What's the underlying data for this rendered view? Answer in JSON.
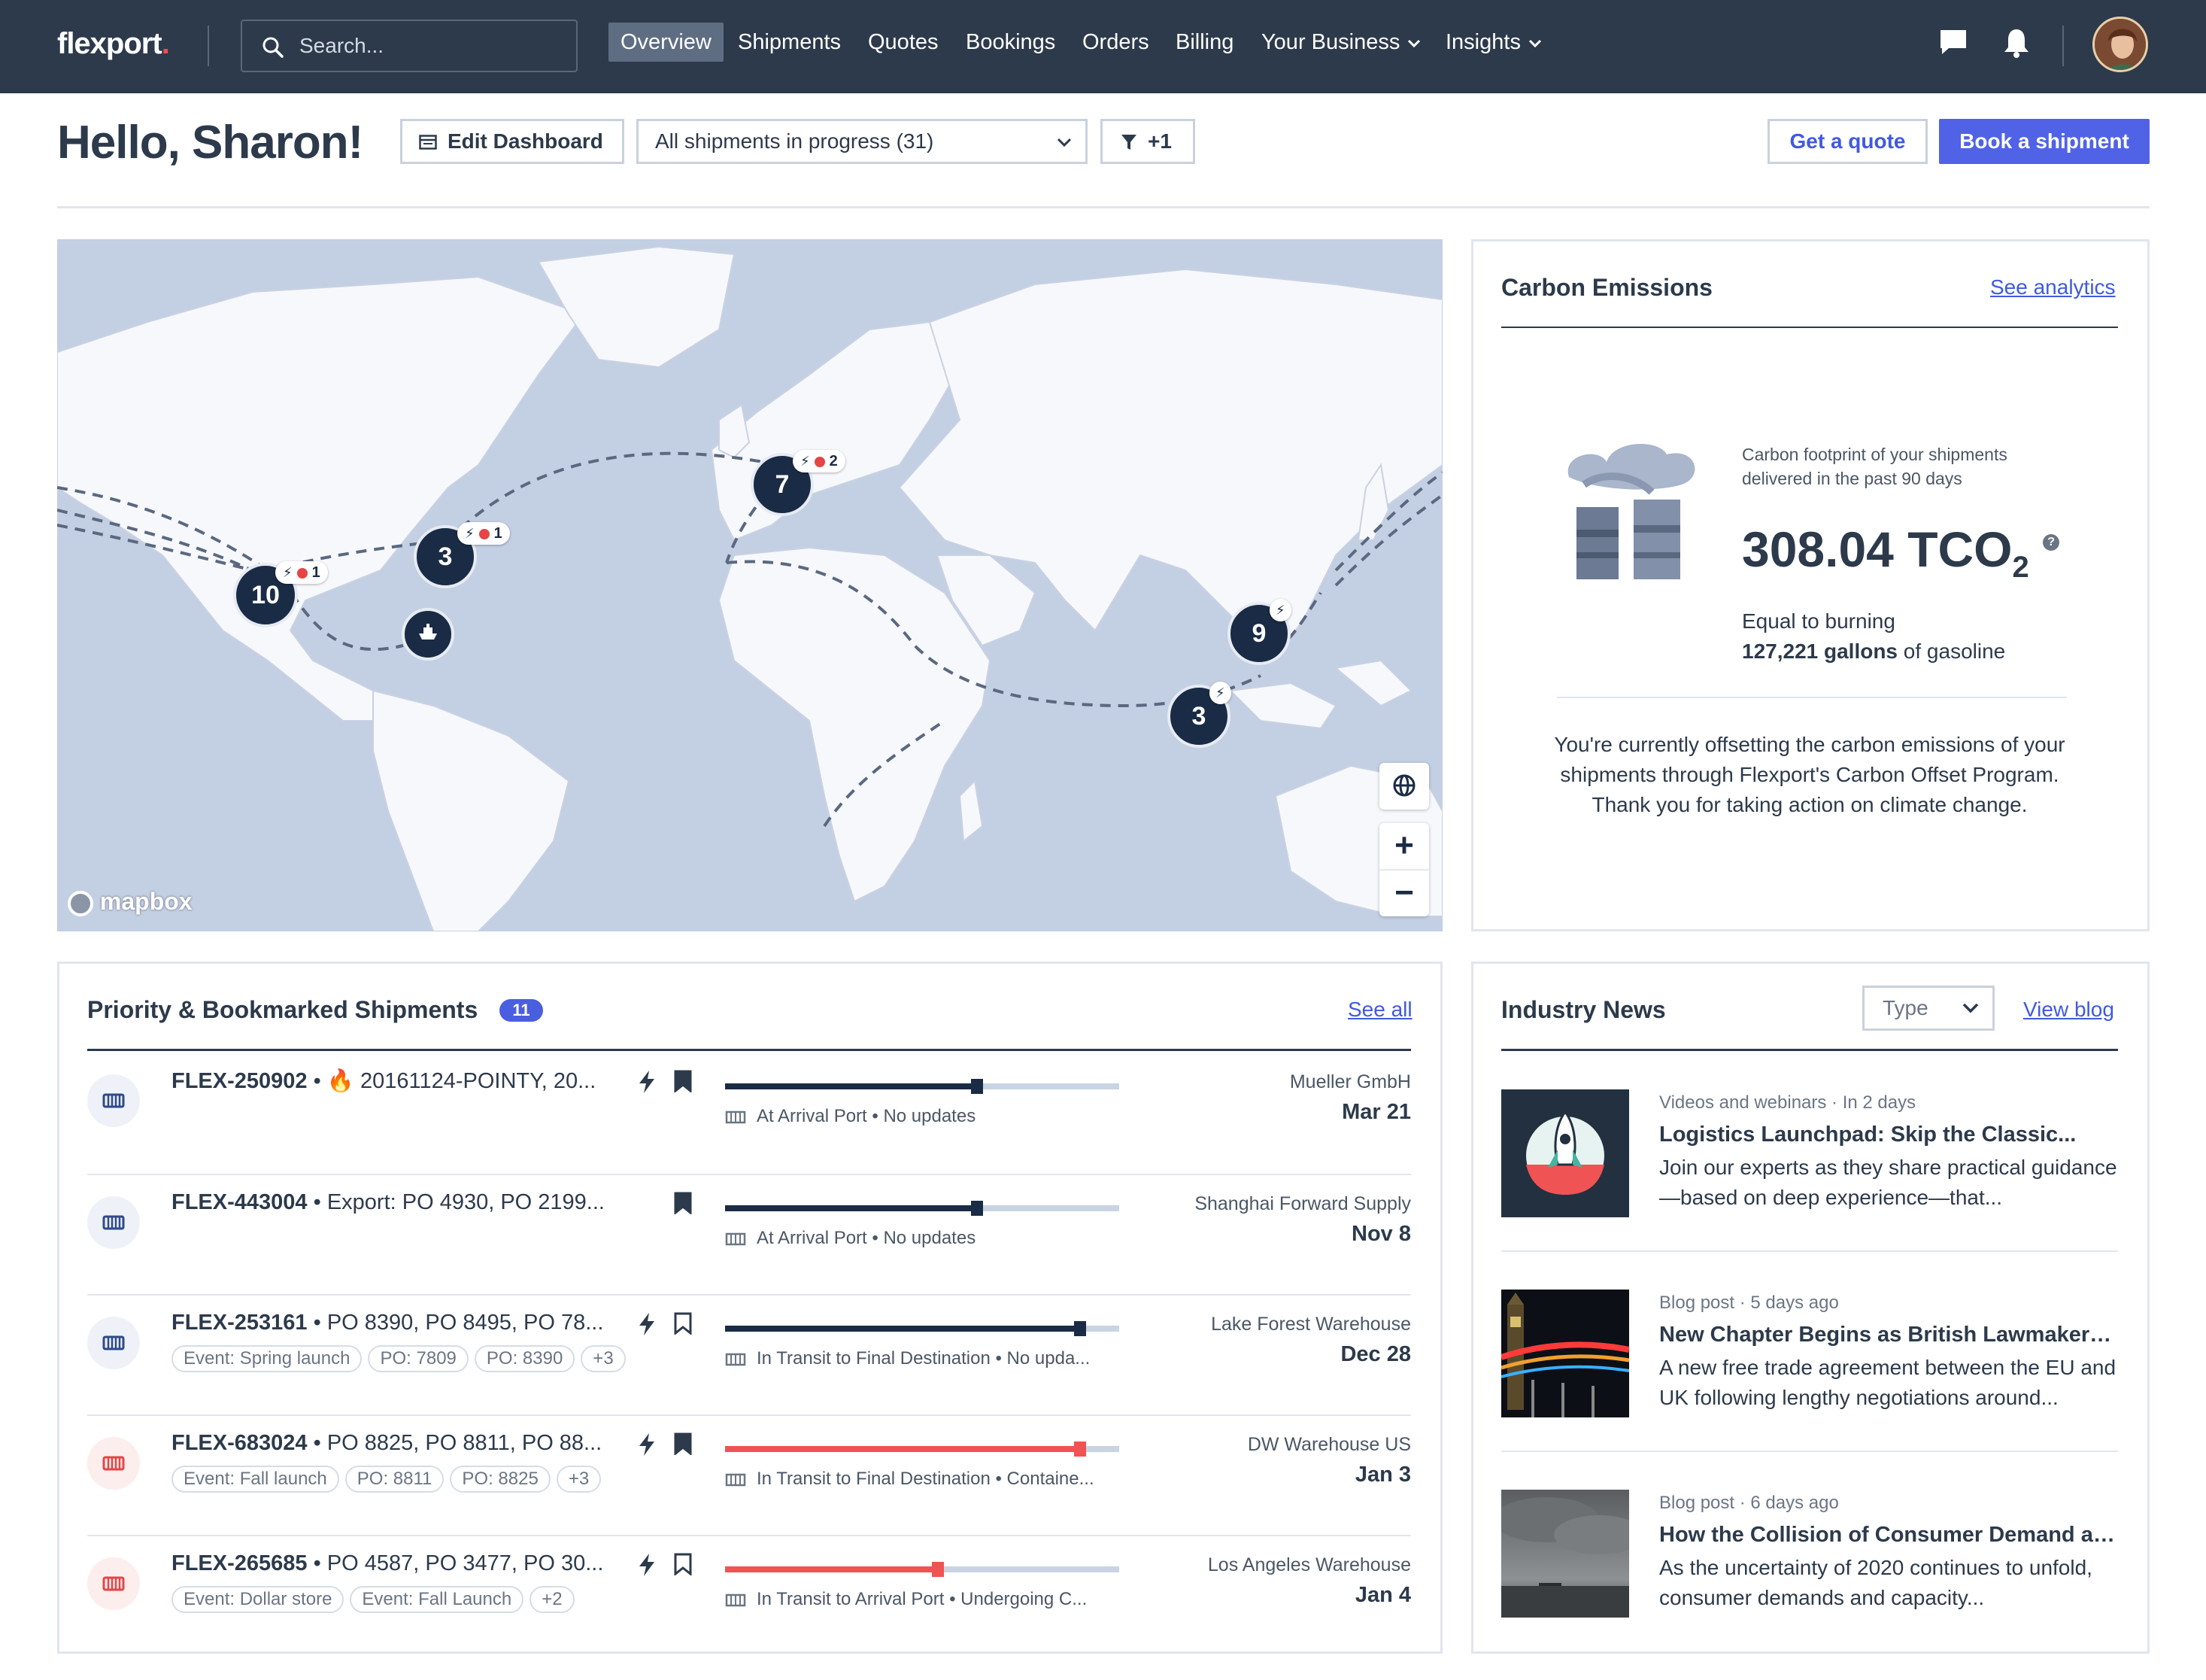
{
  "nav": {
    "logo": "flexport",
    "logo_dot": ".",
    "search_placeholder": "Search...",
    "items": [
      "Overview",
      "Shipments",
      "Quotes",
      "Bookings",
      "Orders",
      "Billing",
      "Your Business",
      "Insights"
    ],
    "active": "Overview"
  },
  "header": {
    "greeting": "Hello, Sharon!",
    "edit_dashboard": "Edit Dashboard",
    "filter_select": "All shipments in progress (31)",
    "filter_count": "+1",
    "get_quote": "Get a quote",
    "book_shipment": "Book a shipment"
  },
  "map": {
    "attribution": "mapbox",
    "clusters": [
      {
        "count": "10",
        "pill": "1"
      },
      {
        "count": "3",
        "pill": "1"
      },
      {
        "count": "7",
        "pill": "2"
      },
      {
        "count": "9",
        "pill": ""
      },
      {
        "count": "3",
        "pill": ""
      }
    ],
    "zoom_in": "+",
    "zoom_out": "−"
  },
  "carbon": {
    "title": "Carbon Emissions",
    "link": "See analytics",
    "footprint_label_1": "Carbon footprint of your shipments",
    "footprint_label_2": "delivered in the past 90 days",
    "value": "308.04 TCO",
    "value_sub": "2",
    "equal_label": "Equal to burning",
    "gallons": "127,221 gallons",
    "gallons_suffix": " of gasoline",
    "offset_1": "You're currently offsetting the carbon emissions of your",
    "offset_2": "shipments through Flexport's Carbon Offset Program.",
    "offset_3": "Thank you for taking action on climate change."
  },
  "priority": {
    "title": "Priority & Bookmarked Shipments",
    "count": "11",
    "link": "See all",
    "rows": [
      {
        "id": "FLEX-250902",
        "desc": "🔥 20161124-POINTY, 20...",
        "status": "At Arrival Port • No updates",
        "dest": "Mueller GmbH",
        "date": "Mar 21",
        "tags": [],
        "progress": 0.64,
        "color": "#1a2b45",
        "hot": true,
        "bolt": true,
        "bookmarked": true,
        "icon_bg": "#eef2f8",
        "icon_color": "#2f4a8a"
      },
      {
        "id": "FLEX-443004",
        "desc": "Export: PO 4930, PO 2199...",
        "status": "At Arrival Port • No updates",
        "dest": "Shanghai Forward Supply",
        "date": "Nov 8",
        "tags": [],
        "progress": 0.64,
        "color": "#1a2b45",
        "hot": false,
        "bolt": false,
        "bookmarked": true,
        "icon_bg": "#eef2f8",
        "icon_color": "#2f4a8a"
      },
      {
        "id": "FLEX-253161",
        "desc": "PO 8390, PO 8495, PO 78...",
        "status": "In Transit to Final Destination • No upda...",
        "dest": "Lake Forest Warehouse",
        "date": "Dec 28",
        "tags": [
          "Event: Spring launch",
          "PO: 7809",
          "PO: 8390",
          "+3"
        ],
        "progress": 0.9,
        "color": "#1a2b45",
        "hot": false,
        "bolt": true,
        "bookmarked": false,
        "icon_bg": "#eef2f8",
        "icon_color": "#2f4a8a"
      },
      {
        "id": "FLEX-683024",
        "desc": "PO 8825, PO 8811, PO 88...",
        "status": "In Transit to Final Destination • Containe...",
        "dest": "DW Warehouse US",
        "date": "Jan 3",
        "tags": [
          "Event: Fall launch",
          "PO: 8811",
          "PO: 8825",
          "+3"
        ],
        "progress": 0.9,
        "color": "#f05353",
        "hot": false,
        "bolt": true,
        "bookmarked": true,
        "icon_bg": "#fdeeee",
        "icon_color": "#e54545"
      },
      {
        "id": "FLEX-265685",
        "desc": "PO 4587, PO 3477, PO 30...",
        "status": "In Transit to Arrival Port • Undergoing C...",
        "dest": "Los Angeles Warehouse",
        "date": "Jan 4",
        "tags": [
          "Event: Dollar store",
          "Event: Fall Launch",
          "+2"
        ],
        "progress": 0.54,
        "color": "#f05353",
        "hot": false,
        "bolt": true,
        "bookmarked": false,
        "icon_bg": "#fdeeee",
        "icon_color": "#e54545"
      }
    ]
  },
  "news": {
    "title": "Industry News",
    "type_select": "Type",
    "link": "View blog",
    "items": [
      {
        "meta": "Videos and webinars · In 2 days",
        "title": "Logistics Launchpad: Skip the Classic...",
        "desc": "Join our experts as they share practical guidance—based on deep experience—that..."
      },
      {
        "meta": "Blog post · 5 days ago",
        "title": "New Chapter Begins as British Lawmakers...",
        "desc": "A new free trade agreement between the EU and UK following lengthy negotiations around..."
      },
      {
        "meta": "Blog post · 6 days ago",
        "title": "How the Collision of Consumer Demand an...",
        "desc": "As the uncertainty of 2020 continues to unfold, consumer demands and capacity..."
      }
    ]
  }
}
